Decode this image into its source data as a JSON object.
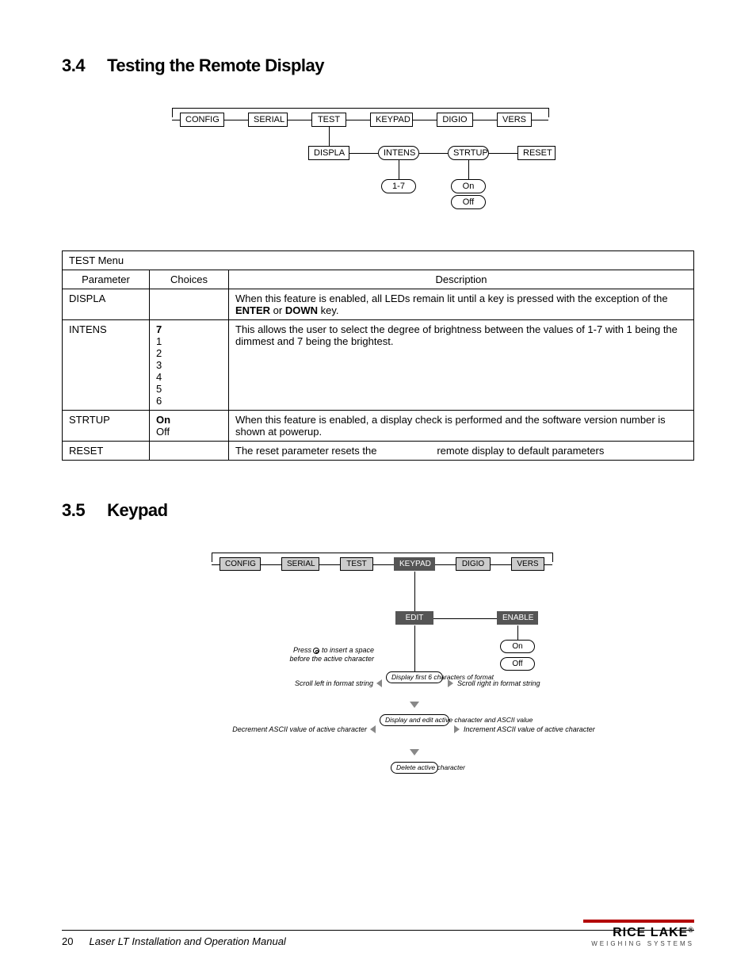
{
  "section34": {
    "num": "3.4",
    "title": "Testing the Remote Display"
  },
  "section35": {
    "num": "3.5",
    "title": "Keypad"
  },
  "diagram1": {
    "row1": [
      "CONFIG",
      "SERIAL",
      "TEST",
      "KEYPAD",
      "DIGIO",
      "VERS"
    ],
    "row2": [
      "DISPLA",
      "INTENS",
      "STRTUP",
      "RESET"
    ],
    "row3": {
      "intens": "1-7",
      "strtup": [
        "On",
        "Off"
      ]
    }
  },
  "table": {
    "caption": "TEST Menu",
    "headers": [
      "Parameter",
      "Choices",
      "Description"
    ],
    "rows": [
      {
        "param": "DISPLA",
        "choices": "",
        "desc_pre": "When this feature is enabled, all LEDs remain lit until a key is pressed with the exception of the ",
        "desc_bold1": "ENTER",
        "desc_mid": " or ",
        "desc_bold2": "DOWN",
        "desc_post": " key."
      },
      {
        "param": "INTENS",
        "choices_bold": "7",
        "choices_rest": [
          "1",
          "2",
          "3",
          "4",
          "5",
          "6"
        ],
        "desc": "This allows the user to select the degree of brightness between the values of 1-7 with 1 being the dimmest and 7 being the brightest."
      },
      {
        "param": "STRTUP",
        "choices_bold": "On",
        "choices_rest": [
          "Off"
        ],
        "desc": "When this feature is enabled, a display check is performed and the software version number is shown at powerup."
      },
      {
        "param": "RESET",
        "choices": "",
        "desc": "The reset parameter resets the                     remote display to default parameters"
      }
    ]
  },
  "diagram2": {
    "row1": [
      "CONFIG",
      "SERIAL",
      "TEST",
      "KEYPAD",
      "DIGIO",
      "VERS"
    ],
    "row2": [
      "EDIT",
      "ENABLE"
    ],
    "enable_opts": [
      "On",
      "Off"
    ],
    "edit_steps": [
      "Display first 6 characters of format",
      "Display and edit active character and ASCII value",
      "Delete active character"
    ],
    "labels": {
      "press_insert": "Press      to insert a space before the active character",
      "scroll_left": "Scroll left in format string",
      "scroll_right": "Scroll right in format string",
      "dec_ascii": "Decrement ASCII value of active character",
      "inc_ascii": "Increment ASCII value of active character"
    }
  },
  "footer": {
    "page": "20",
    "title": "Laser LT Installation and Operation Manual",
    "brand": "RICE LAKE",
    "brand_sub": "WEIGHING SYSTEMS"
  }
}
